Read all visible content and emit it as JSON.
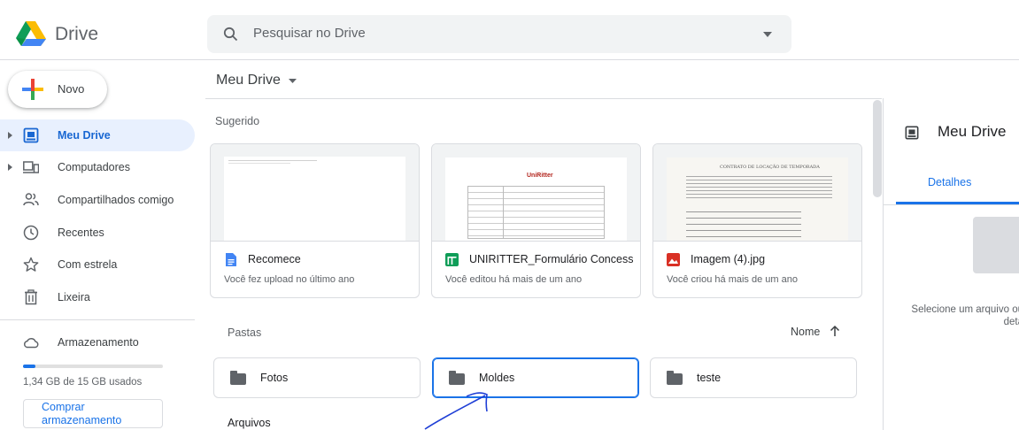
{
  "app": {
    "name": "Drive",
    "search_placeholder": "Pesquisar no Drive"
  },
  "sidebar": {
    "new_label": "Novo",
    "items": [
      {
        "label": "Meu Drive",
        "icon": "my-drive-icon",
        "active": true
      },
      {
        "label": "Computadores",
        "icon": "computers-icon"
      },
      {
        "label": "Compartilhados comigo",
        "icon": "shared-icon"
      },
      {
        "label": "Recentes",
        "icon": "clock-icon"
      },
      {
        "label": "Com estrela",
        "icon": "star-icon"
      },
      {
        "label": "Lixeira",
        "icon": "trash-icon"
      }
    ],
    "storage_label": "Armazenamento",
    "storage_usage": "1,34 GB de 15 GB usados",
    "storage_fraction": 0.09,
    "buy_label_line1": "Comprar",
    "buy_label_line2": "armazenamento"
  },
  "main": {
    "title": "Meu Drive",
    "suggested_label": "Sugerido",
    "suggested": [
      {
        "name": "Recomece",
        "subtitle": "Você fez upload no último ano",
        "icon": "docs-icon",
        "color": "#4285f4"
      },
      {
        "name": "UNIRITTER_Formulário Concess...",
        "subtitle": "Você editou há mais de um ano",
        "icon": "sheets-icon",
        "color": "#0f9d58",
        "thumb_brand": "UniRitter"
      },
      {
        "name": "Imagem (4).jpg",
        "subtitle": "Você criou há mais de um ano",
        "icon": "image-icon",
        "color": "#d93025",
        "thumb_heading": "CONTRATO DE LOCAÇÃO DE TEMPORADA"
      }
    ],
    "folders_label": "Pastas",
    "sort_label": "Nome",
    "folders": [
      {
        "name": "Fotos"
      },
      {
        "name": "Moldes",
        "selected": true
      },
      {
        "name": "teste"
      }
    ],
    "files_label": "Arquivos"
  },
  "details": {
    "title": "Meu Drive",
    "tab": "Detalhes",
    "hint_line1": "Selecione um arquivo ou",
    "hint_line2": "deta"
  },
  "colors": {
    "accent": "#1a73e8",
    "active_bg": "#e8f0fe"
  }
}
